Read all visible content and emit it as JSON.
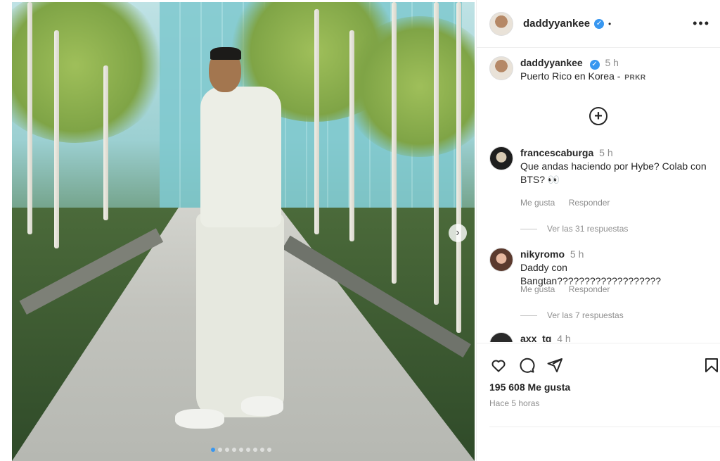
{
  "post": {
    "image_alt": "",
    "carousel_dots": 9,
    "active_dot": 0
  },
  "header": {
    "username": "daddyyankee",
    "separator": "•",
    "more": "•••"
  },
  "caption": {
    "username": "daddyyankee",
    "time": "5 h",
    "text": "Puerto Rico en Korea -",
    "tag": "PRKR"
  },
  "comments": [
    {
      "username": "francescaburga",
      "time": "5 h",
      "text": "Que andas haciendo por Hybe? Colab con BTS? 👀",
      "like_label": "Me gusta",
      "reply_label": "Responder",
      "replies_label": "Ver las 31 respuestas"
    },
    {
      "username": "nikyromo",
      "time": "5 h",
      "text": "Daddy con Bangtan???????????????????",
      "like_label": "Me gusta",
      "reply_label": "Responder",
      "replies_label": "Ver las 7 respuestas"
    },
    {
      "username": "axx_tq",
      "time": "4 h"
    }
  ],
  "footer": {
    "likes": "195 608 Me gusta",
    "posted": "Hace 5 horas"
  },
  "icons": {
    "verified": "verified-badge-icon",
    "more": "more-options-icon",
    "load_more": "plus-circle-icon",
    "like": "heart-icon",
    "comment": "comment-icon",
    "share": "send-icon",
    "save": "bookmark-icon",
    "next": "chevron-right-icon"
  }
}
